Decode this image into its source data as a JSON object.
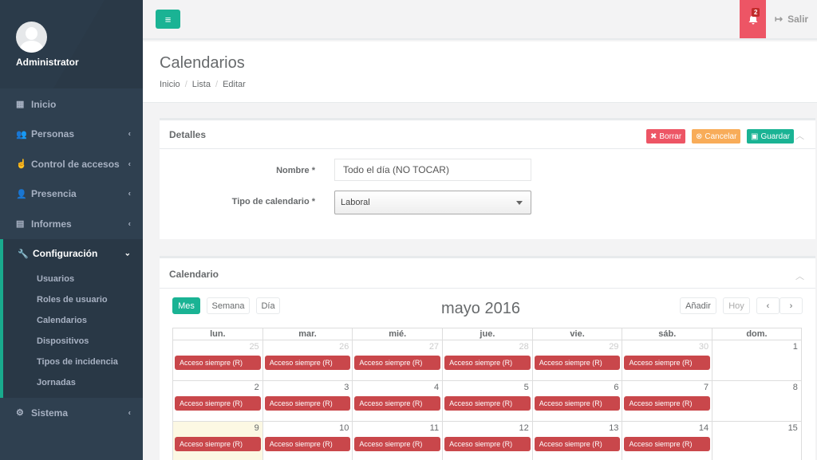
{
  "profile": {
    "name": "Administrator"
  },
  "sidebar": {
    "items": [
      {
        "label": "Inicio",
        "icon": "th-large-icon"
      },
      {
        "label": "Personas",
        "icon": "users-icon"
      },
      {
        "label": "Control de accesos",
        "icon": "hand-icon"
      },
      {
        "label": "Presencia",
        "icon": "user-icon"
      },
      {
        "label": "Informes",
        "icon": "file-icon"
      }
    ],
    "active": {
      "label": "Configuración",
      "icon": "wrench-icon",
      "subitems": [
        "Usuarios",
        "Roles de usuario",
        "Calendarios",
        "Dispositivos",
        "Tipos de incidencia",
        "Jornadas"
      ]
    },
    "last": {
      "label": "Sistema",
      "icon": "gear-icon"
    }
  },
  "topbar": {
    "notifications": "2",
    "logout_label": "Salir"
  },
  "heading": {
    "title": "Calendarios",
    "breadcrumb": [
      "Inicio",
      "Lista",
      "Editar"
    ]
  },
  "details": {
    "title": "Detalles",
    "btn_delete": "Borrar",
    "btn_cancel": "Cancelar",
    "btn_save": "Guardar",
    "name_label": "Nombre *",
    "name_value": "Todo el día (NO TOCAR)",
    "type_label": "Tipo de calendario *",
    "type_value": "Laboral"
  },
  "calendar": {
    "title": "Calendario",
    "view_buttons": [
      "Mes",
      "Semana",
      "Día"
    ],
    "month_title": "mayo 2016",
    "btn_add": "Añadir",
    "btn_today": "Hoy",
    "weekdays": [
      "lun.",
      "mar.",
      "mié.",
      "jue.",
      "vie.",
      "sáb.",
      "dom."
    ],
    "event_label": "Acceso siempre (R)",
    "weeks": [
      [
        {
          "d": "25",
          "o": true,
          "e": true
        },
        {
          "d": "26",
          "o": true,
          "e": true
        },
        {
          "d": "27",
          "o": true,
          "e": true
        },
        {
          "d": "28",
          "o": true,
          "e": true
        },
        {
          "d": "29",
          "o": true,
          "e": true
        },
        {
          "d": "30",
          "o": true,
          "e": true
        },
        {
          "d": "1",
          "o": false,
          "e": false
        }
      ],
      [
        {
          "d": "2",
          "o": false,
          "e": true
        },
        {
          "d": "3",
          "o": false,
          "e": true
        },
        {
          "d": "4",
          "o": false,
          "e": true
        },
        {
          "d": "5",
          "o": false,
          "e": true
        },
        {
          "d": "6",
          "o": false,
          "e": true
        },
        {
          "d": "7",
          "o": false,
          "e": true
        },
        {
          "d": "8",
          "o": false,
          "e": false
        }
      ],
      [
        {
          "d": "9",
          "o": false,
          "e": true,
          "t": true
        },
        {
          "d": "10",
          "o": false,
          "e": true
        },
        {
          "d": "11",
          "o": false,
          "e": true
        },
        {
          "d": "12",
          "o": false,
          "e": true
        },
        {
          "d": "13",
          "o": false,
          "e": true
        },
        {
          "d": "14",
          "o": false,
          "e": true
        },
        {
          "d": "15",
          "o": false,
          "e": false
        }
      ]
    ]
  },
  "colors": {
    "sidebar": "#2f4050",
    "accent": "#1ab394",
    "danger": "#ed5565",
    "warning": "#f8ac59",
    "event": "#c9474b"
  }
}
